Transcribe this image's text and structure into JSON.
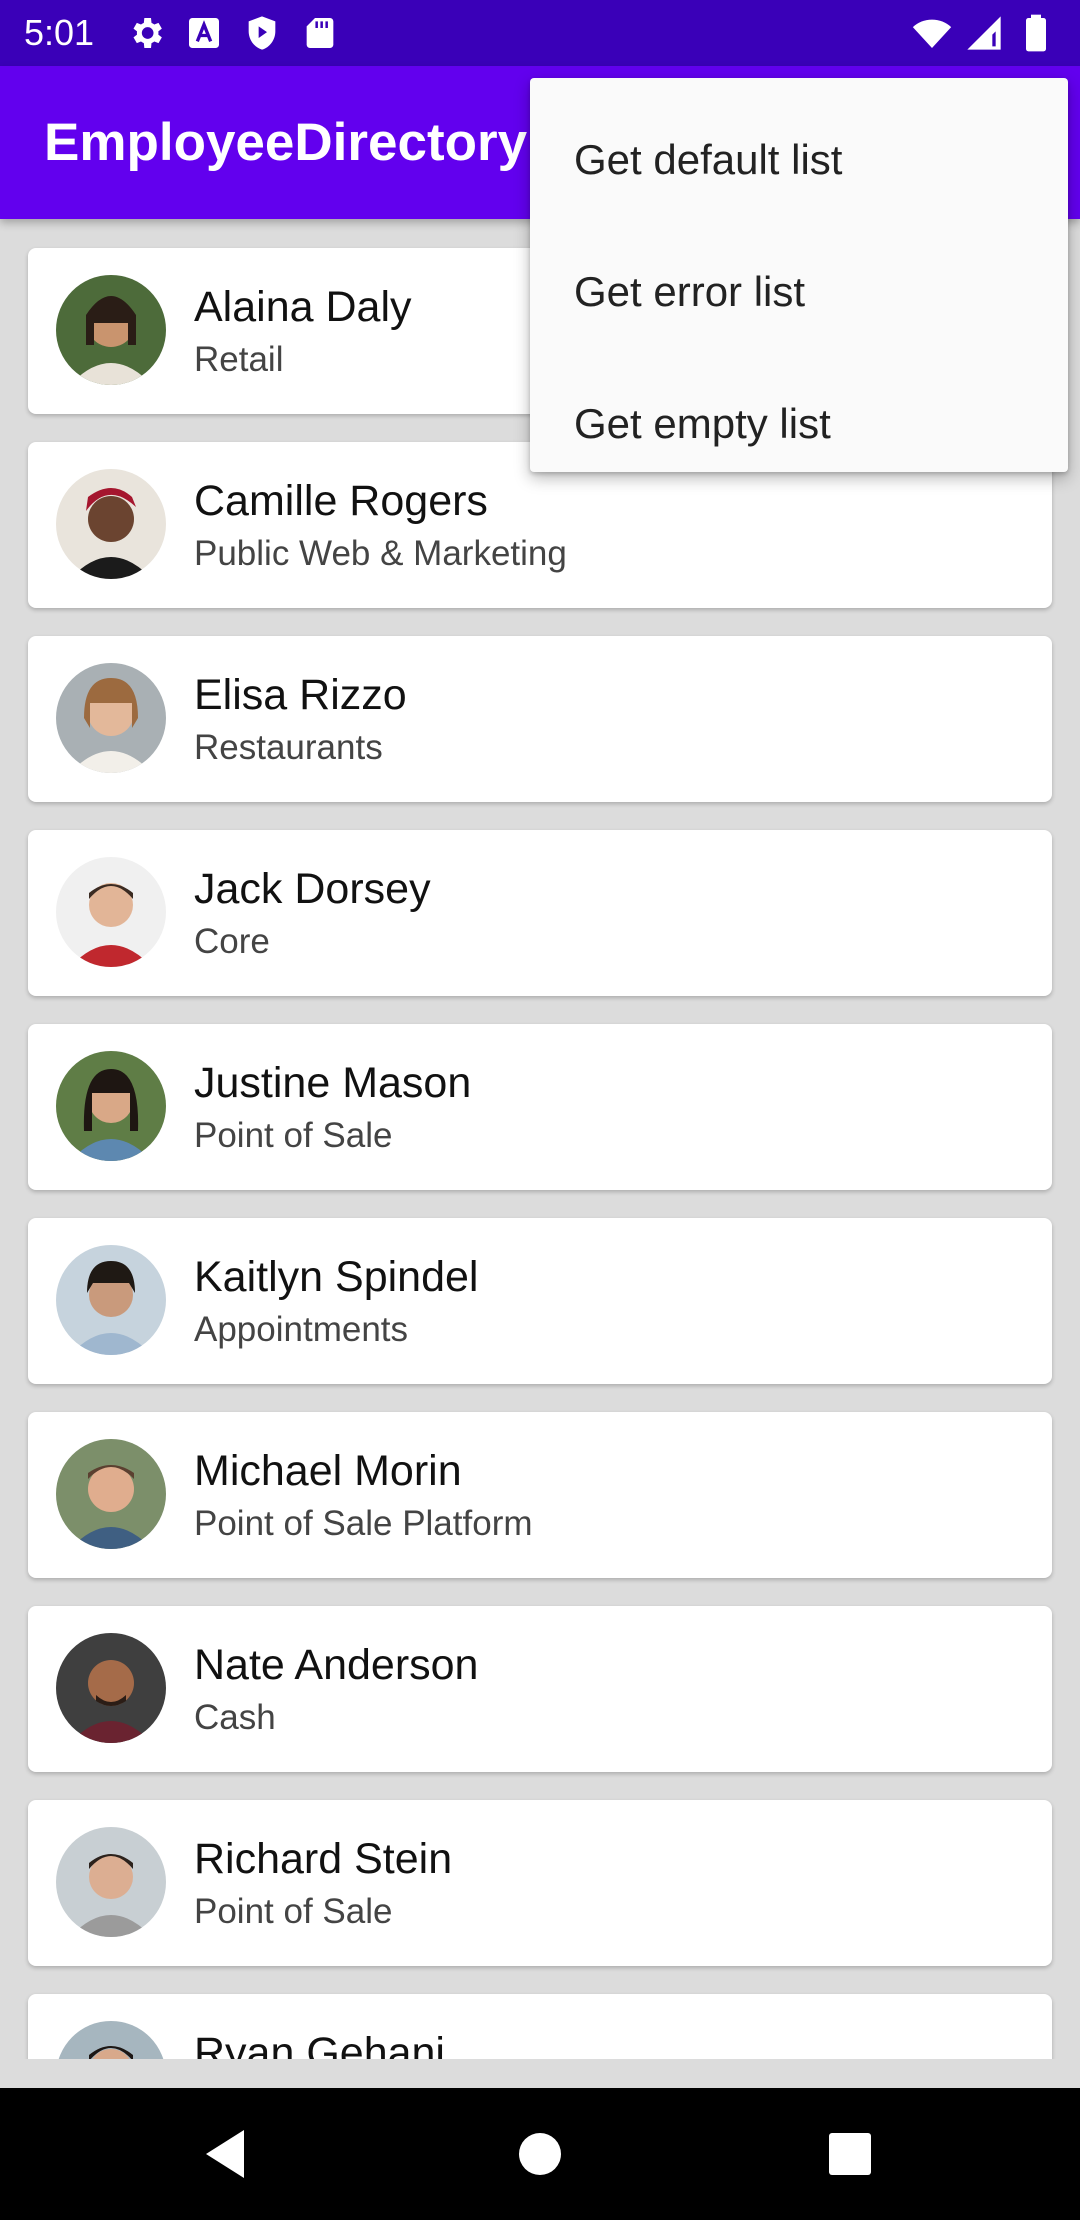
{
  "status_bar": {
    "time": "5:01",
    "left_icons": [
      "settings-icon",
      "font-a-icon",
      "shield-play-icon",
      "sd-card-icon"
    ],
    "right_icons": [
      "wifi-icon",
      "cell-signal-icon",
      "battery-icon"
    ]
  },
  "app_bar": {
    "title": "EmployeeDirectory",
    "color": "#6200ee"
  },
  "menu": {
    "items": [
      "Get default list",
      "Get error list",
      "Get empty list"
    ]
  },
  "employees": [
    {
      "name": "Alaina Daly",
      "team": "Retail"
    },
    {
      "name": "Camille Rogers",
      "team": "Public Web & Marketing"
    },
    {
      "name": "Elisa Rizzo",
      "team": "Restaurants"
    },
    {
      "name": "Jack Dorsey",
      "team": "Core"
    },
    {
      "name": "Justine Mason",
      "team": "Point of Sale"
    },
    {
      "name": "Kaitlyn Spindel",
      "team": "Appointments"
    },
    {
      "name": "Michael Morin",
      "team": "Point of Sale Platform"
    },
    {
      "name": "Nate Anderson",
      "team": "Cash"
    },
    {
      "name": "Richard Stein",
      "team": "Point of Sale"
    },
    {
      "name": "Ryan Gehani",
      "team": ""
    }
  ],
  "nav_bar": {
    "icons": [
      "back-icon",
      "home-icon",
      "recents-icon"
    ]
  }
}
